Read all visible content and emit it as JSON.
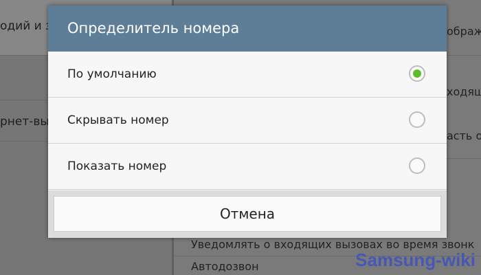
{
  "background": {
    "left_items": [
      "одий и з",
      "",
      "рнет-вы"
    ],
    "right_items": [
      "ображ",
      "ходящ",
      "асть о"
    ],
    "bottom_items": [
      "Уведомлять о входящих вызовах во время звонк",
      "Автодозвон"
    ]
  },
  "dialog": {
    "title": "Определитель номера",
    "options": [
      {
        "label": "По умолчанию",
        "checked": true
      },
      {
        "label": "Скрывать номер",
        "checked": false
      },
      {
        "label": "Показать номер",
        "checked": false
      }
    ],
    "cancel_label": "Отмена"
  },
  "watermark": "Samsung-wiki",
  "colors": {
    "header": "#5e7e98",
    "radio_selected": "#5cbf2a",
    "watermark": "#4757b5"
  }
}
